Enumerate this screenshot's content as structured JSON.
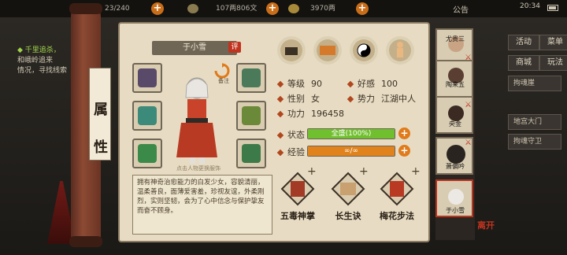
{
  "topbar": {
    "stamina_value": "23/240",
    "money": "107两806文",
    "gold": "3970两",
    "announcement": "公告",
    "time": "20:34"
  },
  "quest": {
    "line1": "◆ 千里追杀，",
    "line2": "和峨岭追来",
    "line3": "情况，寻找线索"
  },
  "right_menu": {
    "row1": [
      "活动",
      "菜单"
    ],
    "row2": [
      "商城",
      "玩法"
    ],
    "lower_buttons": [
      "拘魂崖",
      "地宫大门",
      "拘魂守卫"
    ]
  },
  "scroll": {
    "tab_chars": [
      "属",
      "性"
    ],
    "close_label": "离开"
  },
  "character": {
    "name": "于小雪",
    "evaluate_label": "评",
    "change_label": "备注",
    "hint": "点击人物更换服饰",
    "description": "拥有神奇治愈能力的白发少女，容貌清丽，温柔善良，面薄爱害羞，珍视友谊，外柔刚烈，实则坚韧，会为了心中信念与保护挚友而奋不顾身。"
  },
  "top_icons": [
    "tattoo-icon",
    "scroll-icon",
    "yin-yang-icon",
    "body-meridian-icon"
  ],
  "stats": {
    "level_label": "等级",
    "level_value": "90",
    "favor_label": "好感",
    "favor_value": "100",
    "gender_label": "性别",
    "gender_value": "女",
    "faction_label": "势力",
    "faction_value": "江湖中人",
    "power_label": "功力",
    "power_value": "196458"
  },
  "status_bar": {
    "label": "状态",
    "text": "全盛(100%)",
    "fill_fraction": 1.0,
    "color": "#6fbf2e"
  },
  "exp_bar": {
    "label": "经验",
    "text": "∞/∞",
    "fill_fraction": 1.0,
    "color": "#e0831c"
  },
  "skills": [
    {
      "name": "五毒神掌",
      "icon": "palm-scroll-icon"
    },
    {
      "name": "长生诀",
      "icon": "longevity-scroll-icon"
    },
    {
      "name": "梅花步法",
      "icon": "plum-step-scroll-icon"
    }
  ],
  "roster": [
    {
      "name": "尤贵三"
    },
    {
      "name": "陶来五"
    },
    {
      "name": "央金"
    },
    {
      "name": "萧偏吟"
    },
    {
      "name": "于小雪"
    }
  ],
  "colors": {
    "panel_bg": "#e7dcc3",
    "accent_orange": "#e07a1a",
    "status_green": "#6fbf2e",
    "flag_red": "#c0341f"
  }
}
